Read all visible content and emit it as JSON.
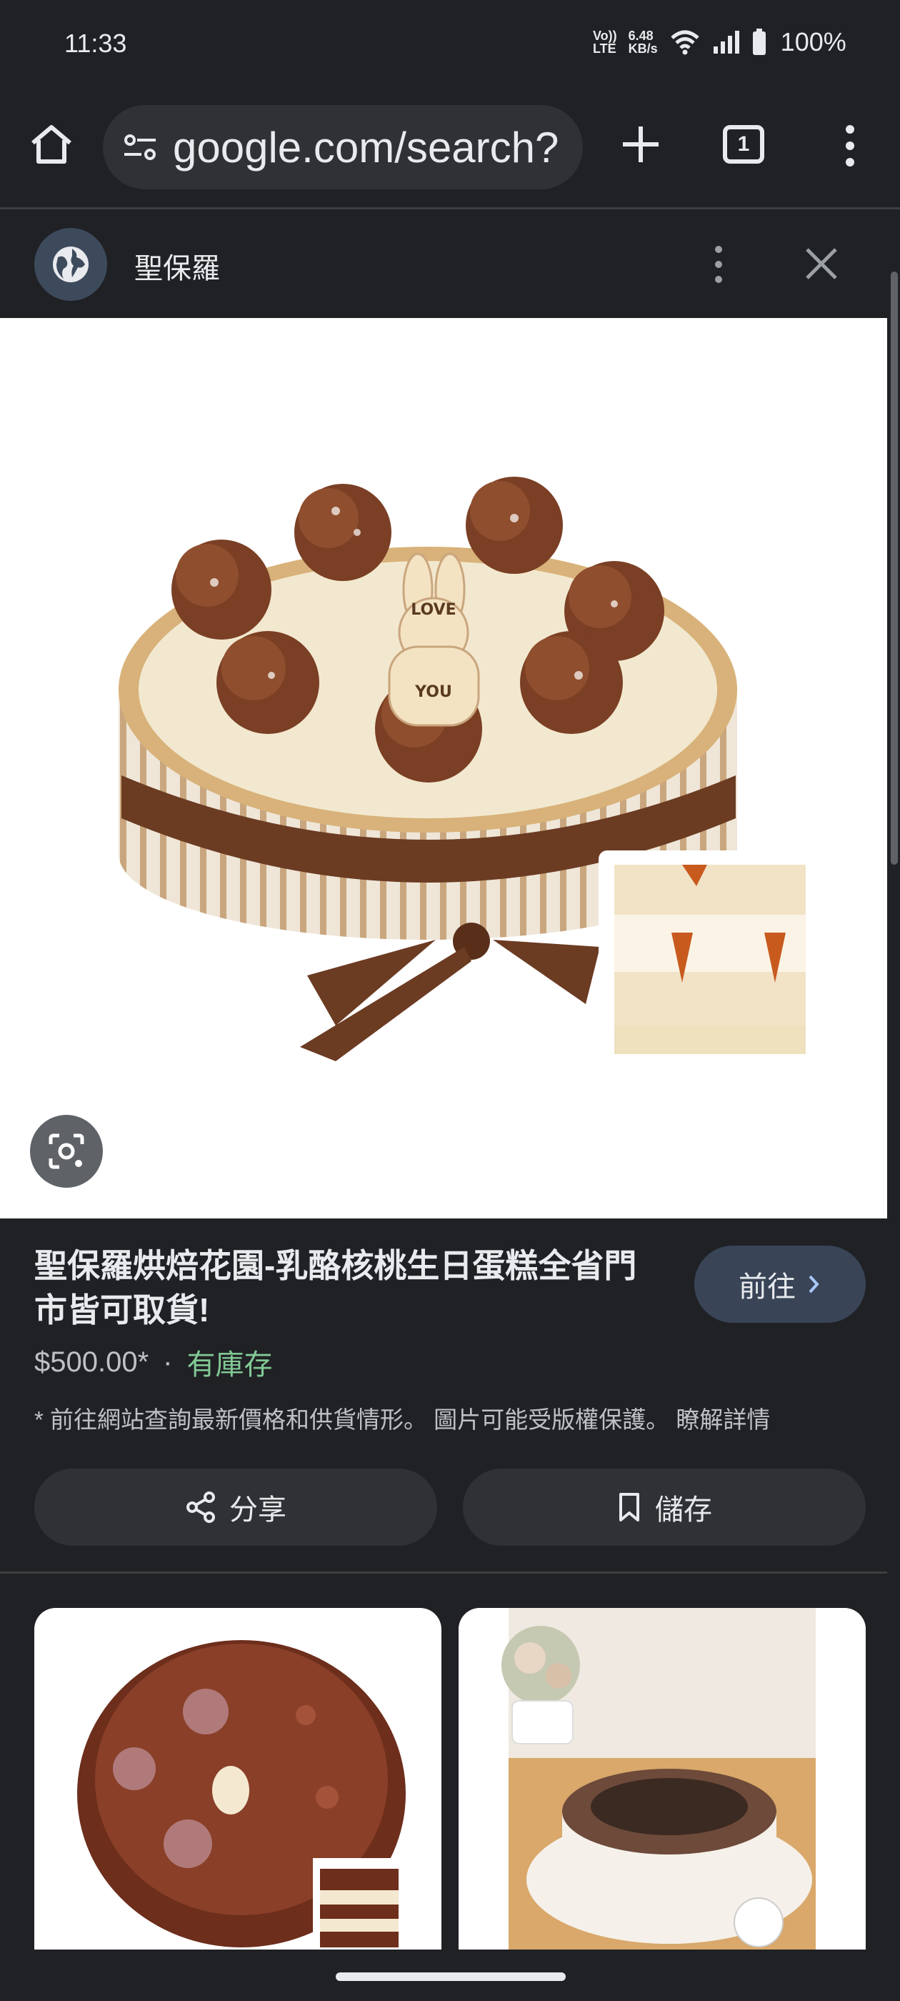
{
  "status_bar": {
    "time": "11:33",
    "volte_top": "Vo))",
    "volte_bottom": "LTE",
    "speed_top": "6.48",
    "speed_bottom": "KB/s",
    "battery": "100%"
  },
  "browser": {
    "url": "google.com/search?",
    "tab_count": "1"
  },
  "source": {
    "name": "聖保羅"
  },
  "product": {
    "title": "聖保羅烘焙花園-乳酪核桃生日蛋糕全省門市皆可取貨!",
    "price": "$500.00*",
    "separator": "·",
    "stock": "有庫存",
    "disclaimer": "* 前往網站查詢最新價格和供貨情形。 圖片可能受版權保護。 瞭解詳情",
    "visit_label": "前往",
    "share_label": "分享",
    "save_label": "儲存"
  },
  "cake_topper": {
    "line1": "LOVE",
    "line2": "YOU"
  },
  "colors": {
    "background": "#202124",
    "accent_button": "#394457",
    "stock_green": "#81c995"
  },
  "icons": [
    "home-icon",
    "site-settings-icon",
    "plus-icon",
    "tabs-icon",
    "more-vert-icon",
    "globe-icon",
    "close-icon",
    "lens-icon",
    "chevron-right-icon",
    "share-icon",
    "bookmark-icon"
  ]
}
